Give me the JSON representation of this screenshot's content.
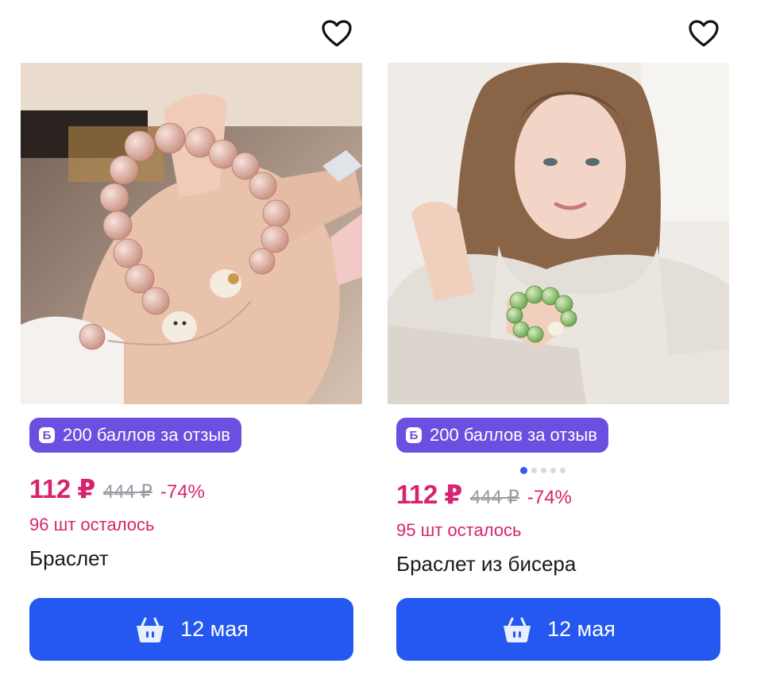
{
  "products": [
    {
      "bonus": {
        "icon": "Б",
        "label": "200 баллов за отзыв"
      },
      "price": "112 ₽",
      "old_price": "444 ₽",
      "discount": "-74%",
      "stock": "96 шт осталось",
      "title": "Браслет",
      "delivery_label": "12 мая",
      "image": "photo of pink bead bracelet on open hand"
    },
    {
      "bonus": {
        "icon": "Б",
        "label": "200 баллов за отзыв"
      },
      "price": "112 ₽",
      "old_price": "444 ₽",
      "discount": "-74%",
      "stock": "95 шт осталось",
      "title": "Браслет из бисера",
      "delivery_label": "12 мая",
      "image": "photo of woman wearing green bead bracelet",
      "carousel": {
        "count": 5,
        "active": 1
      }
    }
  ],
  "icons": {
    "favorite": "heart-icon",
    "basket": "basket-icon"
  },
  "colors": {
    "accent": "#2458f0",
    "price": "#d6246e",
    "badge": "#6a4fe0"
  }
}
